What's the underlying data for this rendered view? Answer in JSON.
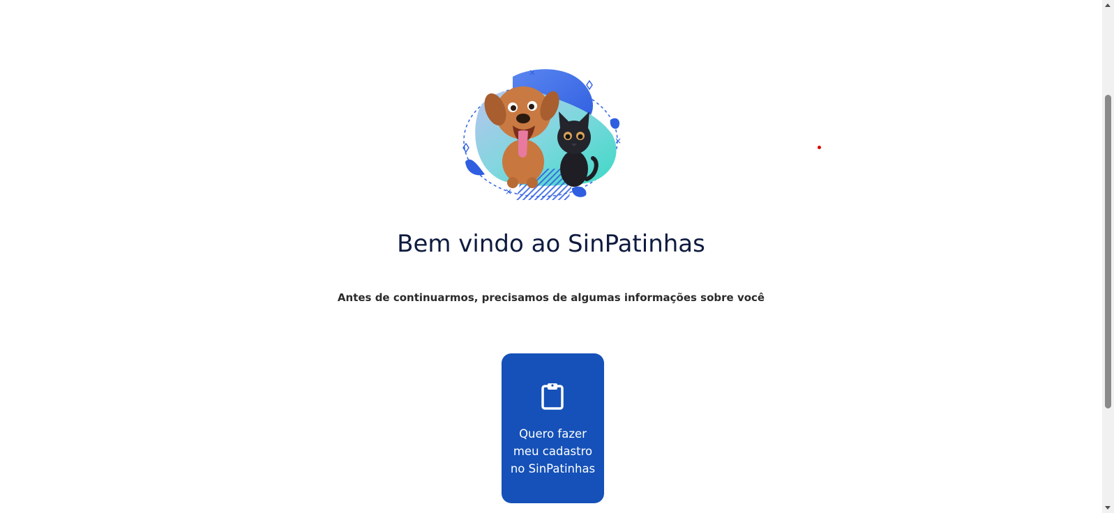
{
  "hero": {
    "image_name": "dog-and-cat-illustration"
  },
  "welcome": {
    "title": "Bem vindo ao SinPatinhas",
    "subtitle": "Antes de continuarmos, precisamos de algumas informações sobre você"
  },
  "options": [
    {
      "icon": "clipboard-icon",
      "label": "Quero fazer meu cadastro no SinPatinhas",
      "color": "#1551b8"
    }
  ],
  "colors": {
    "title": "#0e1a3f",
    "card": "#1551b8"
  }
}
